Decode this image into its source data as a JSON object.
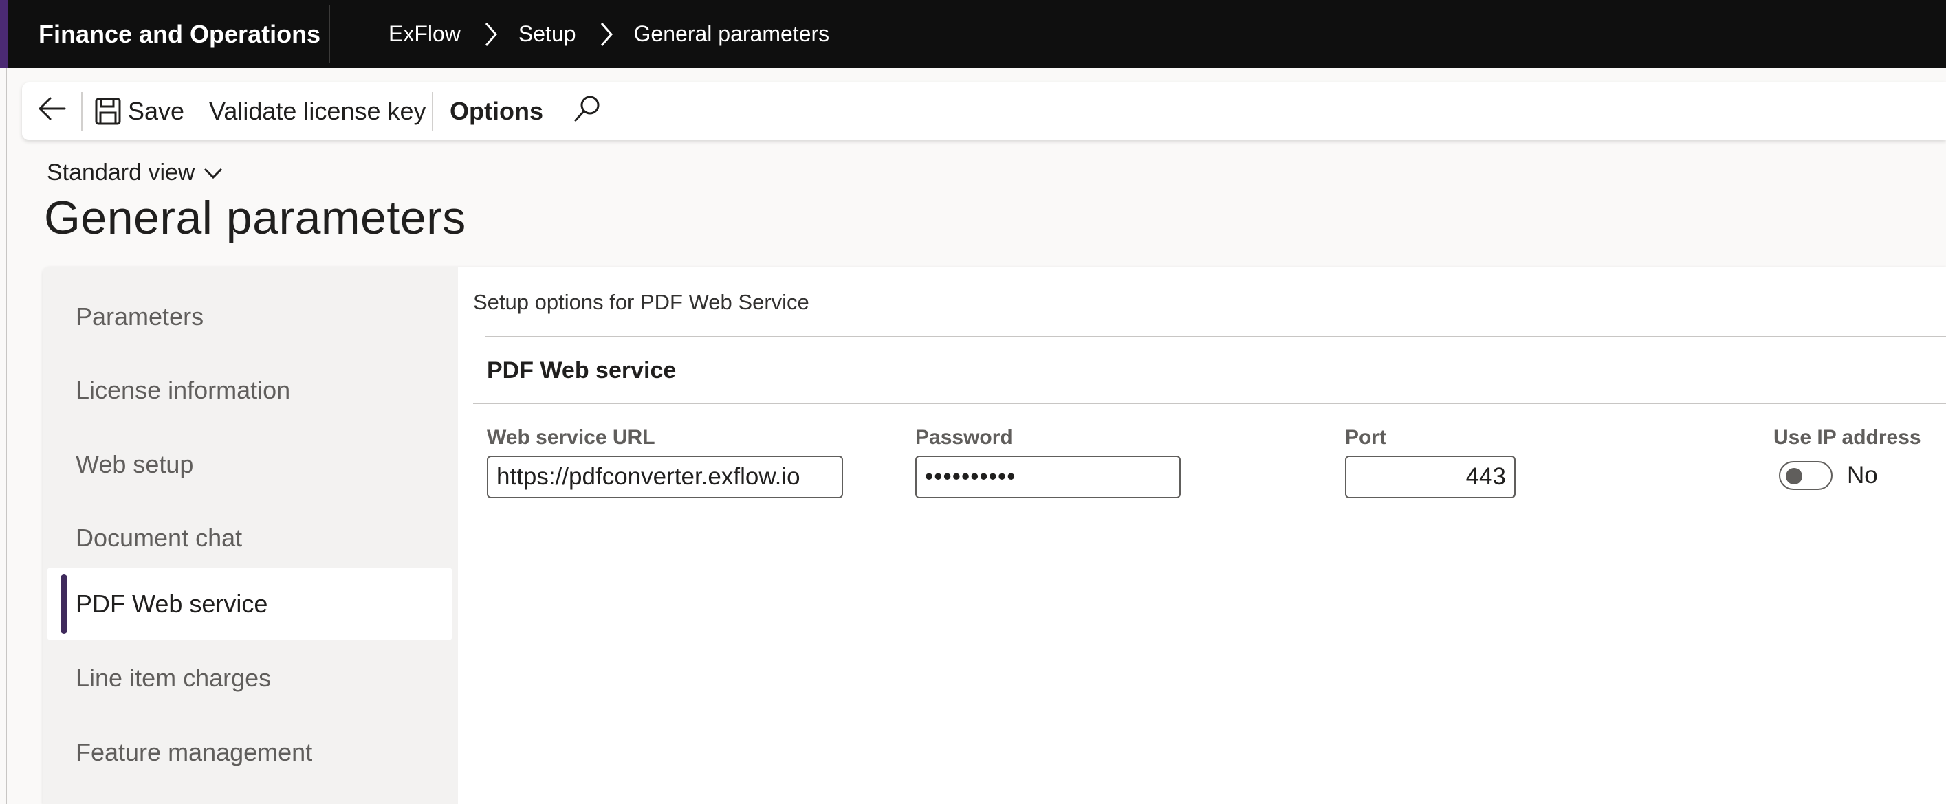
{
  "topbar": {
    "app_name": "Finance and Operations",
    "breadcrumb": [
      "ExFlow",
      "Setup",
      "General parameters"
    ]
  },
  "actionpane": {
    "back_icon": "arrow-left-icon",
    "save_icon": "floppy-disk-icon",
    "save_label": "Save",
    "validate_label": "Validate license key",
    "options_label": "Options",
    "search_icon": "search-icon"
  },
  "header": {
    "view_label": "Standard view",
    "title": "General parameters"
  },
  "sidebar": {
    "items": [
      {
        "label": "Parameters"
      },
      {
        "label": "License information"
      },
      {
        "label": "Web setup"
      },
      {
        "label": "Document chat"
      },
      {
        "label": "PDF Web service"
      },
      {
        "label": "Line item charges"
      },
      {
        "label": "Feature management"
      }
    ],
    "selected_index": 4
  },
  "main": {
    "description": "Setup options for PDF Web Service",
    "group_title": "PDF Web service",
    "fields": {
      "url_label": "Web service URL",
      "url_value": "https://pdfconverter.exflow.io",
      "password_label": "Password",
      "password_value": "••••••••••",
      "port_label": "Port",
      "port_value": "443",
      "use_ip_label": "Use IP address",
      "use_ip_value": "No"
    }
  },
  "colors": {
    "topbar_bg": "#0f0f0f",
    "accent": "#3f2a5c",
    "page_bg": "#faf9f8"
  }
}
